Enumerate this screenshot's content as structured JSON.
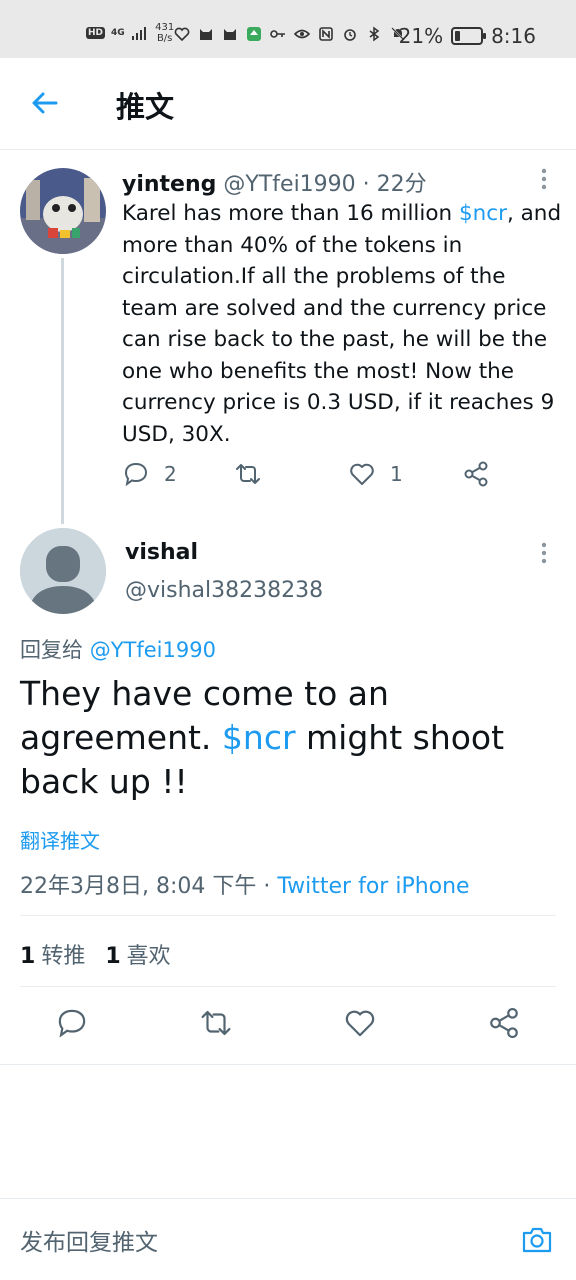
{
  "status_bar": {
    "hd": "HD",
    "signal": "4G",
    "speed_value": "431",
    "speed_unit": "B/s",
    "battery_text": "21%",
    "battery_level": 0.21,
    "time": "8:16"
  },
  "header": {
    "title": "推文",
    "back_icon": "arrow-left-icon"
  },
  "parent_tweet": {
    "name": "yinteng",
    "handle": "@YTfei1990",
    "separator": " · ",
    "time": "22分",
    "text_before": "Karel has more than 16 million ",
    "cashtag": "$ncr",
    "text_after": ", and more than 40% of the tokens in circulation.If all the problems of the team are solved and the currency price can rise back to the past, he will be the one who benefits the most! Now the currency price is 0.3 USD, if it reaches 9 USD, 30X.",
    "reply_count": "2",
    "retweet_count": "",
    "like_count": "1"
  },
  "main_tweet": {
    "name": "vishal",
    "handle": "@vishal38238238",
    "reply_to_prefix": "回复给 ",
    "reply_to_handle": "@YTfei1990",
    "text_before": "They have come to an agreement. ",
    "cashtag": "$ncr",
    "text_after": " might shoot back up !!",
    "translate": "翻译推文",
    "date": "22年3月8日, 8:04 下午",
    "dot": " · ",
    "source": "Twitter for iPhone",
    "retweets_num": "1",
    "retweets_label": "转推",
    "likes_num": "1",
    "likes_label": "喜欢"
  },
  "reply_bar": {
    "placeholder": "发布回复推文",
    "camera_icon": "camera-icon"
  },
  "colors": {
    "accent": "#1d9bf0",
    "text": "#0f1419",
    "muted": "#536471"
  }
}
